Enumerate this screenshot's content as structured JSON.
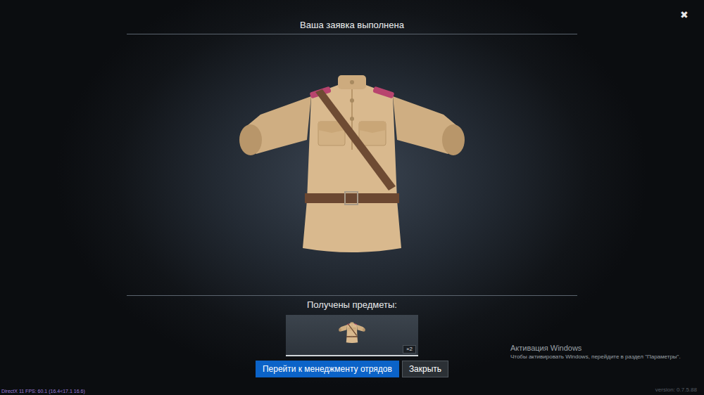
{
  "dialog": {
    "title": "Ваша заявка выполнена",
    "close": "✖"
  },
  "received": {
    "label": "Получены предметы:",
    "items": [
      {
        "count": "×2"
      }
    ]
  },
  "buttons": [
    {
      "label": "Перейти к менеджменту отрядов",
      "kind": "primary"
    },
    {
      "label": "Закрыть",
      "kind": "secondary"
    }
  ],
  "watermark": {
    "title": "Активация Windows",
    "text": "Чтобы активировать Windows, перейдите в раздел \"Параметры\"."
  },
  "debug": "DirectX 11 FPS: 60.1 (16.4<17.1 16.6)",
  "version": "version: 0.7.5.88"
}
